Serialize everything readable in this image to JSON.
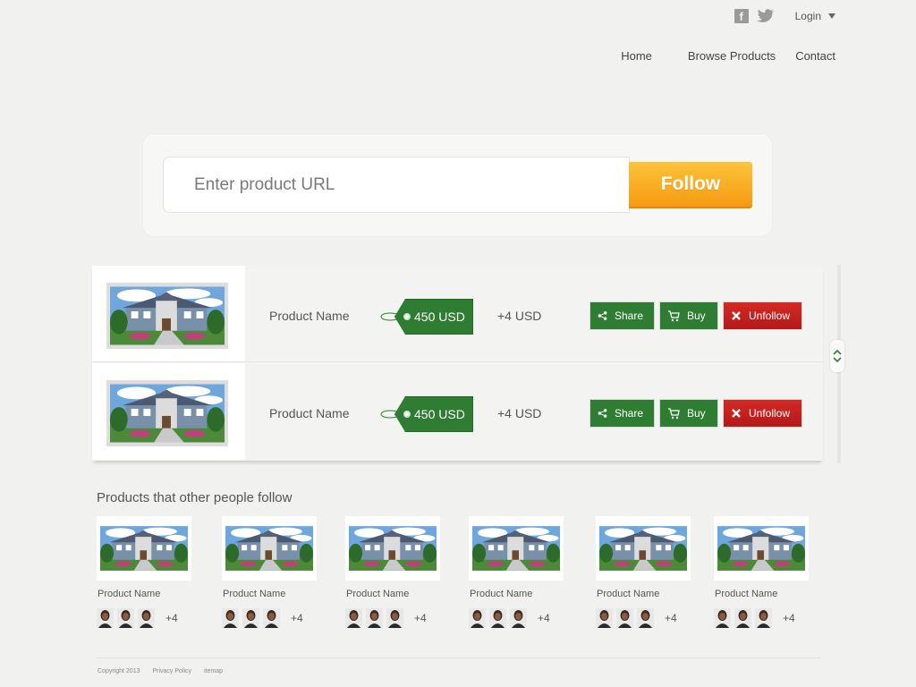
{
  "header": {
    "social": {
      "facebook_glyph": "f",
      "icons": [
        "facebook-icon",
        "twitter-icon"
      ]
    },
    "login_label": "Login",
    "nav": [
      "Home",
      "Browse Products",
      "Contact"
    ]
  },
  "search": {
    "placeholder": "Enter product URL",
    "value": "",
    "button_label": "Follow"
  },
  "followed": [
    {
      "name": "Product Name",
      "price": "450 USD",
      "change": "+4  USD",
      "actions": [
        "Share",
        "Buy",
        "Unfollow"
      ]
    },
    {
      "name": "Product Name",
      "price": "450 USD",
      "change": "+4  USD",
      "actions": [
        "Share",
        "Buy",
        "Unfollow"
      ]
    }
  ],
  "others": {
    "title": "Products that other people follow",
    "cards": [
      {
        "name": "Product Name",
        "more": "+4"
      },
      {
        "name": "Product Name",
        "more": "+4"
      },
      {
        "name": "Product Name",
        "more": "+4"
      },
      {
        "name": "Product Name",
        "more": "+4"
      },
      {
        "name": "Product Name",
        "more": "+4"
      },
      {
        "name": "Product Name",
        "more": "+4"
      }
    ]
  },
  "footer": {
    "copyright": "Copyright 2013",
    "links": [
      "Privacy Policy",
      "itemap"
    ]
  },
  "colors": {
    "background": "#f1f1f0",
    "follow_button": "#f7a81b",
    "green_button": "#2e7d32",
    "unfollow_button": "#c4201f"
  }
}
